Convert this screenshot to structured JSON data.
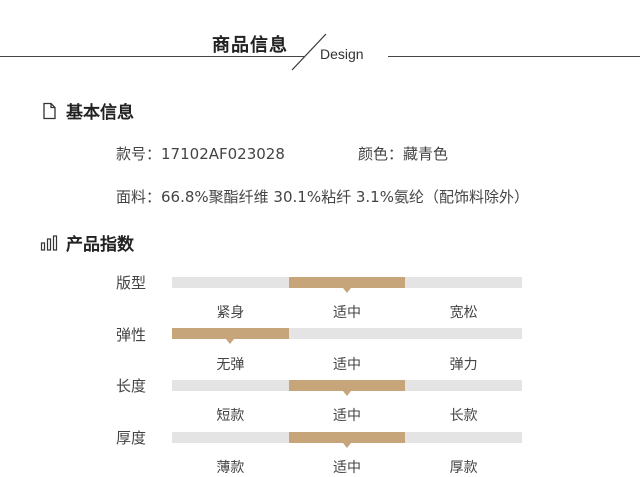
{
  "header": {
    "title": "商品信息",
    "subtitle": "Design"
  },
  "basic": {
    "heading": "基本信息",
    "style_no_label": "款号：",
    "style_no_value": "17102AF023028",
    "color_label": "颜色：",
    "color_value": "藏青色",
    "fabric_label": "面料：",
    "fabric_value": "66.8%聚酯纤维 30.1%粘纤 3.1%氨纶（配饰料除外）"
  },
  "index": {
    "heading": "产品指数",
    "rows": [
      {
        "label": "版型",
        "options": [
          "紧身",
          "适中",
          "宽松"
        ],
        "selected": 1
      },
      {
        "label": "弹性",
        "options": [
          "无弹",
          "适中",
          "弹力"
        ],
        "selected": 0
      },
      {
        "label": "长度",
        "options": [
          "短款",
          "适中",
          "长款"
        ],
        "selected": 1
      },
      {
        "label": "厚度",
        "options": [
          "薄款",
          "适中",
          "厚款"
        ],
        "selected": 1
      }
    ]
  },
  "colors": {
    "accent": "#c6a57b",
    "track": "#e4e4e4",
    "text": "#444444"
  }
}
